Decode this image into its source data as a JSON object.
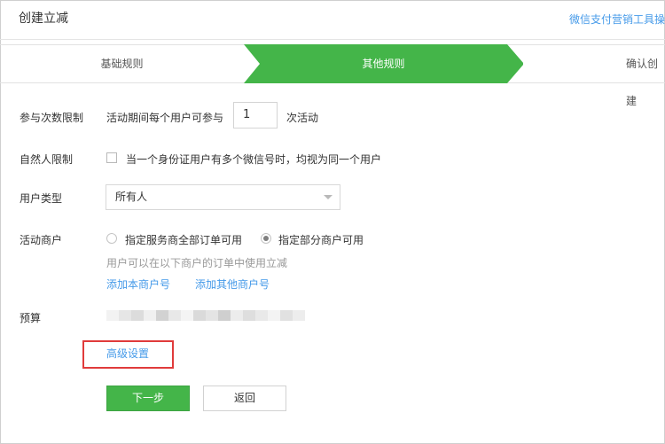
{
  "header": {
    "title": "创建立减",
    "tool_link": "微信支付营销工具操"
  },
  "steps": [
    {
      "label": "基础规则",
      "active": false
    },
    {
      "label": "其他规则",
      "active": true
    },
    {
      "label": "确认创建",
      "active": false
    }
  ],
  "colors": {
    "accent_green": "#44b549",
    "link_blue": "#459ae9",
    "highlight_red": "#e03b3b"
  },
  "form": {
    "participation": {
      "label": "参与次数限制",
      "prefix": "活动期间每个用户可参与",
      "value": "1",
      "suffix": "次活动"
    },
    "natural_person": {
      "label": "自然人限制",
      "checkbox_text": "当一个身份证用户有多个微信号时，均视为同一个用户",
      "checked": false
    },
    "user_type": {
      "label": "用户类型",
      "selected": "所有人"
    },
    "merchant": {
      "label": "活动商户",
      "options": [
        {
          "label": "指定服务商全部订单可用",
          "checked": false
        },
        {
          "label": "指定部分商户可用",
          "checked": true
        }
      ],
      "hint": "用户可以在以下商户的订单中使用立减",
      "add_own_link": "添加本商户号",
      "add_other_link": "添加其他商户号"
    },
    "budget": {
      "label": "预算"
    },
    "advanced_link": "高级设置"
  },
  "actions": {
    "next_label": "下一步",
    "back_label": "返回"
  }
}
